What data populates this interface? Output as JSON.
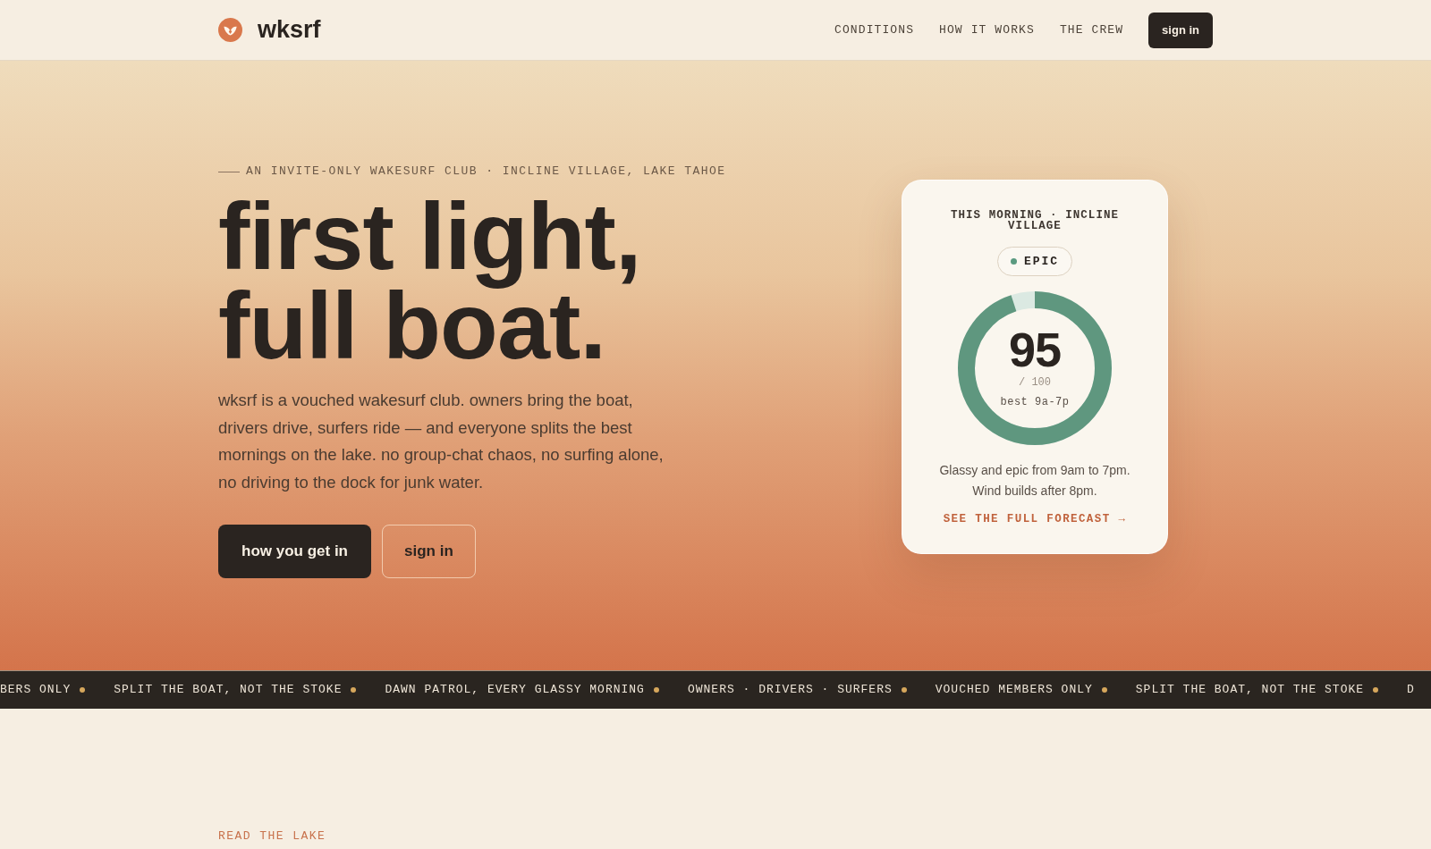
{
  "nav": {
    "brand": "wksrf",
    "links": [
      {
        "label": "CONDITIONS"
      },
      {
        "label": "HOW IT WORKS"
      },
      {
        "label": "THE CREW"
      }
    ],
    "sign_in": "sign in"
  },
  "hero": {
    "eyebrow": "AN INVITE-ONLY WAKESURF CLUB · INCLINE VILLAGE, LAKE TAHOE",
    "headline_lines": [
      "first light,",
      "full boat."
    ],
    "intro": "wksrf is a vouched wakesurf club. owners bring the boat, drivers drive, surfers ride — and everyone splits the best mornings on the lake. no group-chat chaos, no surfing alone, no driving to the dock for junk water.",
    "buttons": [
      {
        "label": "how you get in",
        "kind": "primary"
      },
      {
        "label": "sign in",
        "kind": "outline"
      }
    ]
  },
  "conditions_card": {
    "title": "THIS MORNING · INCLINE VILLAGE",
    "rating": "EPIC",
    "score": "95",
    "score_max": "/ 100",
    "best_window": "best 9a-7p",
    "level": 0.95,
    "summary": "Glassy and epic from 9am to 7pm. Wind builds after 8pm.",
    "forecast_link": "SEE THE FULL FORECAST →"
  },
  "ticker": [
    "BERS ONLY",
    "SPLIT THE BOAT, NOT THE STOKE",
    "DAWN PATROL, EVERY GLASSY MORNING",
    "OWNERS · DRIVERS · SURFERS",
    "VOUCHED MEMBERS ONLY",
    "SPLIT THE BOAT, NOT THE STOKE",
    "D"
  ],
  "next_section": {
    "eyebrow": "READ THE LAKE"
  }
}
